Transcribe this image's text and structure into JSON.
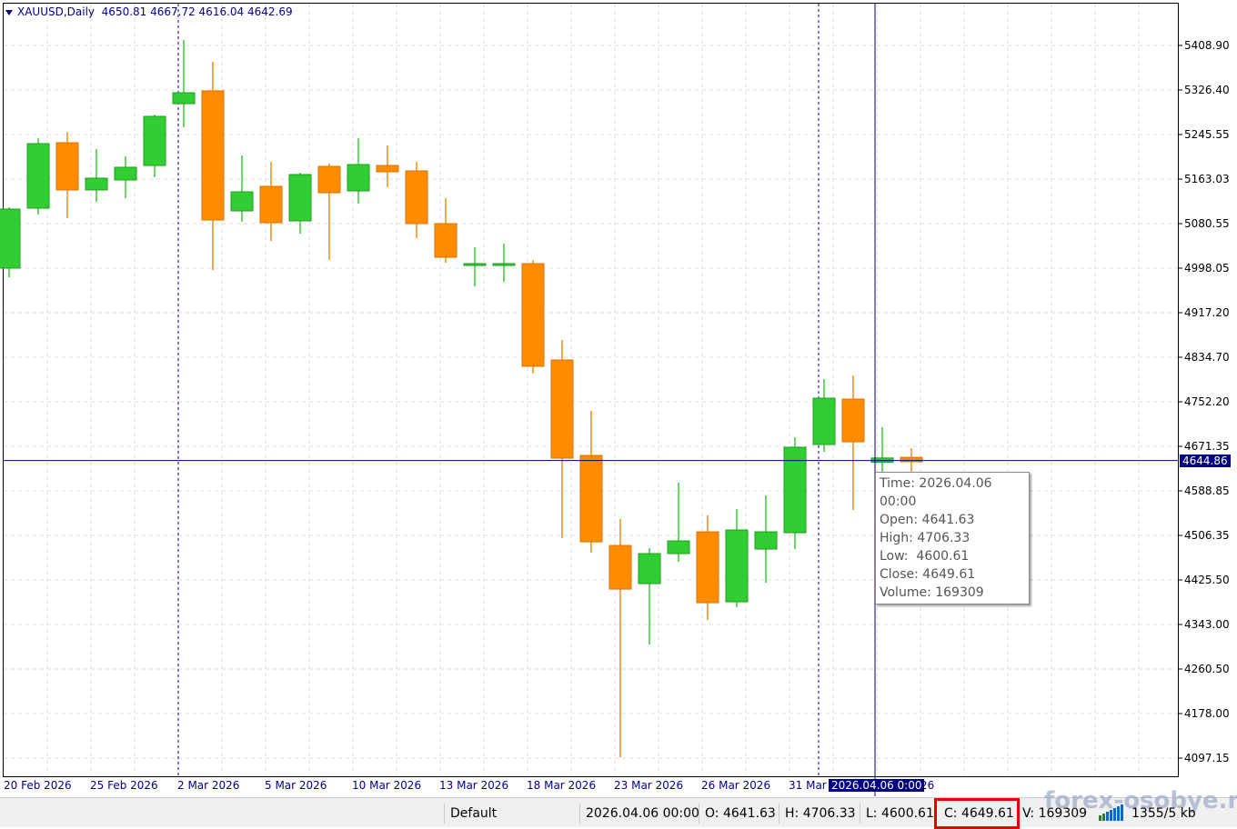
{
  "header": {
    "symbol": "XAUUSD,Daily",
    "ohlc": "4650.81 4667.72 4616.04 4642.69"
  },
  "price_axis": [
    "5408.90",
    "5326.40",
    "5245.55",
    "5163.03",
    "5080.55",
    "4998.05",
    "4917.20",
    "4834.70",
    "4752.20",
    "4671.35",
    "4588.85",
    "4506.35",
    "4425.50",
    "4343.00",
    "4260.50",
    "4178.00",
    "4097.15"
  ],
  "crosshair": {
    "price": "4644.86",
    "time": "2026.04.06 0:00",
    "price_value": 4644.86
  },
  "date_axis": [
    "20 Feb 2026",
    "25 Feb 2026",
    "2 Mar 2026",
    "5 Mar 2026",
    "10 Mar 2026",
    "13 Mar 2026",
    "18 Mar 2026",
    "23 Mar 2026",
    "26 Mar 2026",
    "31 Mar 2026",
    "26"
  ],
  "tooltip": {
    "time": "Time: 2026.04.06 00:00",
    "open": "Open: 4641.63",
    "high": "High: 4706.33",
    "low": "Low:  4600.61",
    "close": "Close: 4649.61",
    "volume": "Volume: 169309"
  },
  "status": {
    "profile": "Default",
    "time": "2026.04.06 00:00",
    "open": "O: 4641.63",
    "high": "H: 4706.33",
    "low": "L: 4600.61",
    "close": "C: 4649.61",
    "volume": "V: 169309",
    "traffic": "1355/5 kb"
  },
  "watermark": "forex-osobye.ru",
  "colors": {
    "bull": "#32cd32",
    "bear": "#ff8c00",
    "axis": "#00008b",
    "crosshair": "#000080",
    "highlight": "#e00000"
  },
  "chart_data": {
    "type": "candlestick",
    "ylim": [
      4097.15,
      5408.9
    ],
    "candles": [
      [
        4999.0,
        5111.1,
        4982.2,
        5107.7
      ],
      [
        5109.4,
        5238.2,
        5097.7,
        5228.2
      ],
      [
        5229.9,
        5249.9,
        5091.0,
        5142.9
      ],
      [
        5142.9,
        5218.2,
        5121.1,
        5164.6
      ],
      [
        5161.3,
        5204.8,
        5127.8,
        5184.7
      ],
      [
        5188.0,
        5281.7,
        5166.3,
        5278.4
      ],
      [
        5301.8,
        5418.9,
        5258.3,
        5321.9
      ],
      [
        5325.2,
        5378.8,
        4995.6,
        5087.6
      ],
      [
        5104.4,
        5206.4,
        5084.3,
        5139.5
      ],
      [
        5149.6,
        5194.7,
        5049.2,
        5082.6
      ],
      [
        5086.0,
        5174.7,
        5062.5,
        5171.3
      ],
      [
        5186.4,
        5191.4,
        5014.0,
        5137.8
      ],
      [
        5141.2,
        5238.2,
        5117.8,
        5189.7
      ],
      [
        5188.0,
        5224.8,
        5147.9,
        5176.3
      ],
      [
        5178.0,
        5194.7,
        5054.2,
        5081.0
      ],
      [
        5081.0,
        5127.8,
        5009.0,
        5019.0
      ],
      [
        5007.3,
        5037.4,
        4965.5,
        5007.3
      ],
      [
        5007.3,
        5044.1,
        4973.9,
        5007.3
      ],
      [
        5007.3,
        5014.0,
        4804.9,
        4818.3
      ],
      [
        4830.0,
        4866.8,
        4502.0,
        4649.3
      ],
      [
        4654.3,
        4736.3,
        4475.3,
        4495.3
      ],
      [
        4488.6,
        4537.2,
        4098.8,
        4408.3
      ],
      [
        4418.4,
        4483.6,
        4306.3,
        4473.6
      ],
      [
        4473.6,
        4604.1,
        4458.5,
        4497.0
      ],
      [
        4513.7,
        4543.9,
        4351.4,
        4383.2
      ],
      [
        4384.9,
        4555.6,
        4374.9,
        4517.1
      ],
      [
        4481.9,
        4580.7,
        4420.0,
        4513.7
      ],
      [
        4512.1,
        4687.7,
        4481.9,
        4669.3
      ],
      [
        4674.4,
        4794.8,
        4661.0,
        4759.7
      ],
      [
        4758.0,
        4801.5,
        4553.9,
        4679.4
      ],
      [
        4641.63,
        4706.33,
        4600.61,
        4649.61
      ],
      [
        4650.81,
        4667.72,
        4616.04,
        4642.69
      ]
    ]
  }
}
